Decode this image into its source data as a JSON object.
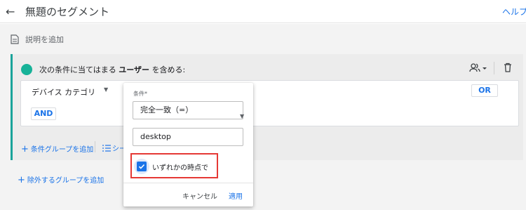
{
  "header": {
    "title": "無題のセグメント",
    "help": "ヘルプセ"
  },
  "description": {
    "label": "説明を追加"
  },
  "condition_group": {
    "prefix": "次の条件に当てはまる",
    "scope": "ユーザー",
    "suffix": "を含める:",
    "dimension": "デバイス カテゴリ",
    "or_label": "OR",
    "and_label": "AND"
  },
  "actions": {
    "add_group": "条件グループを追加",
    "sequence": "シー",
    "exclude_group": "除外するグループを追加"
  },
  "popup": {
    "condition_label": "条件*",
    "match_type": "完全一致（=）",
    "value": "desktop",
    "checkbox_label": "いずれかの時点で",
    "checkbox_checked": true,
    "cancel": "キャンセル",
    "apply": "適用"
  },
  "colors": {
    "accent": "#1a73e8",
    "group_dot": "#17b298",
    "highlight": "#e53935"
  },
  "icons": [
    "arrow-back-icon",
    "description-icon",
    "people-icon",
    "chevron-down-icon",
    "trash-icon",
    "plus-icon",
    "sequence-icon",
    "check-icon"
  ]
}
